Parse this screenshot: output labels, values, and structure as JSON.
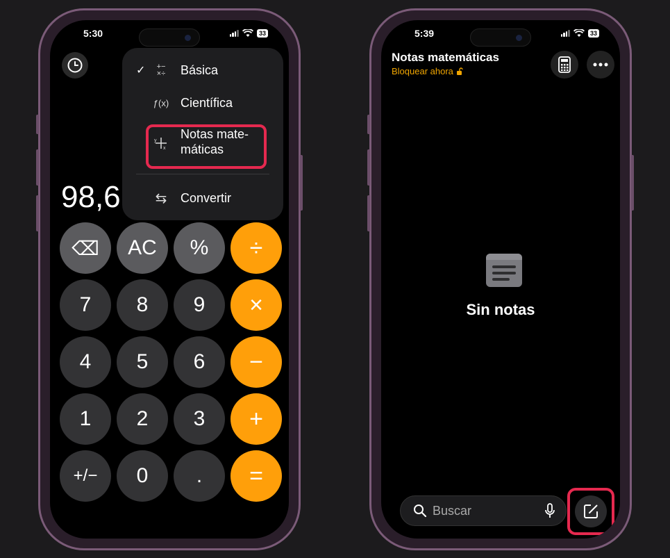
{
  "left_phone": {
    "status": {
      "time": "5:30",
      "battery": "33"
    },
    "display_value": "98,6",
    "menu": {
      "items": [
        {
          "label": "Básica",
          "checked": true,
          "icon": "basic-operators-icon",
          "glyph": "+−\n×÷"
        },
        {
          "label": "Científica",
          "checked": false,
          "icon": "function-icon",
          "glyph": "ƒ(x)"
        },
        {
          "label": "Notas mate-\nmáticas",
          "checked": false,
          "icon": "math-notes-icon",
          "glyph": "y/x"
        },
        {
          "label": "Convertir",
          "checked": false,
          "icon": "convert-arrows-icon",
          "glyph": "⇆"
        }
      ],
      "check_glyph": "✓"
    },
    "keys": [
      [
        "⌫",
        "AC",
        "%",
        "÷"
      ],
      [
        "7",
        "8",
        "9",
        "×"
      ],
      [
        "4",
        "5",
        "6",
        "−"
      ],
      [
        "1",
        "2",
        "3",
        "+"
      ],
      [
        "+/−",
        "0",
        ".",
        "="
      ]
    ]
  },
  "right_phone": {
    "status": {
      "time": "5:39",
      "battery": "33"
    },
    "title": "Notas matemáticas",
    "lock_label": "Bloquear ahora",
    "empty_text": "Sin notas",
    "search_placeholder": "Buscar"
  },
  "colors": {
    "highlight": "#e5294f",
    "operator": "#ff9f0a",
    "lock": "#f0a500"
  }
}
